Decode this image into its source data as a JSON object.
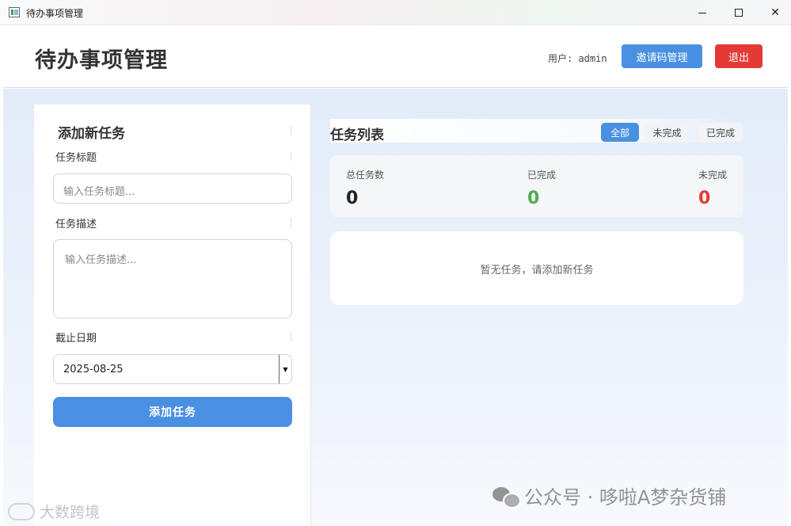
{
  "window": {
    "title": "待办事项管理"
  },
  "header": {
    "title": "待办事项管理",
    "user_label": "用户: admin",
    "invite_button": "邀请码管理",
    "logout_button": "退出"
  },
  "form": {
    "heading": "添加新任务",
    "title_label": "任务标题",
    "title_placeholder": "输入任务标题...",
    "desc_label": "任务描述",
    "desc_placeholder": "输入任务描述...",
    "date_label": "截止日期",
    "date_value": "2025-08-25",
    "submit_button": "添加任务"
  },
  "task_list": {
    "heading": "任务列表",
    "filters": [
      {
        "label": "全部",
        "active": true
      },
      {
        "label": "未完成",
        "active": false
      },
      {
        "label": "已完成",
        "active": false
      }
    ],
    "empty_message": "暂无任务，请添加新任务"
  },
  "stats": [
    {
      "label": "总任务数",
      "value": "0",
      "color": "#222222"
    },
    {
      "label": "已完成",
      "value": "0",
      "color": "#4caf50"
    },
    {
      "label": "未完成",
      "value": "0",
      "color": "#e53935"
    }
  ],
  "watermarks": {
    "wechat": "公众号 · 哆啦A梦杂货铺",
    "bottom_left": "大数跨境"
  },
  "colors": {
    "primary": "#4a90e2",
    "danger": "#e53935",
    "success": "#4caf50"
  }
}
